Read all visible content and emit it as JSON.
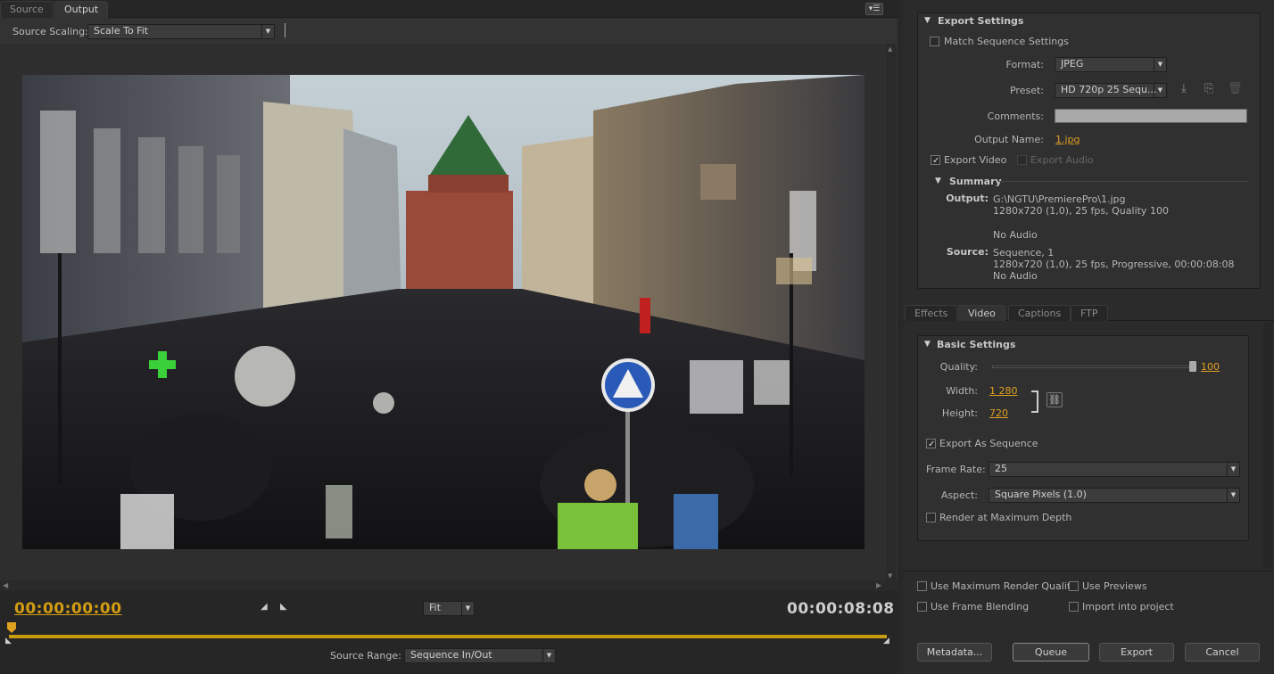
{
  "tabs": {
    "source": "Source",
    "output": "Output"
  },
  "scaling": {
    "label": "Source Scaling:",
    "value": "Scale To Fit"
  },
  "playback": {
    "current_tc": "00:00:00:00",
    "duration_tc": "00:00:08:08",
    "zoom": "Fit",
    "range_label": "Source Range:",
    "range_value": "Sequence In/Out"
  },
  "export_settings": {
    "header": "Export Settings",
    "match_label": "Match Sequence Settings",
    "format_label": "Format:",
    "format_value": "JPEG",
    "preset_label": "Preset:",
    "preset_value": "HD 720p 25 Sequ...",
    "comments_label": "Comments:",
    "output_name_label": "Output Name:",
    "output_name_value": "1.jpg",
    "export_video": "Export Video",
    "export_audio": "Export Audio"
  },
  "summary": {
    "header": "Summary",
    "output_label": "Output:",
    "output_lines": [
      "G:\\NGTU\\PremierePro\\1.jpg",
      "1280x720 (1,0), 25 fps, Quality 100",
      "No Audio"
    ],
    "source_label": "Source:",
    "source_lines": [
      "Sequence, 1",
      "1280x720 (1,0), 25 fps, Progressive, 00:00:08:08",
      "No Audio"
    ]
  },
  "right_tabs": [
    "Effects",
    "Video",
    "Captions",
    "FTP"
  ],
  "basic": {
    "header": "Basic Settings",
    "quality_label": "Quality:",
    "quality_value": "100",
    "quality_fraction": 1.0,
    "width_label": "Width:",
    "width_value": "1 280",
    "height_label": "Height:",
    "height_value": "720",
    "export_seq": "Export As Sequence",
    "frame_rate_label": "Frame Rate:",
    "frame_rate_value": "25",
    "aspect_label": "Aspect:",
    "aspect_value": "Square Pixels (1.0)",
    "render_max": "Render at Maximum Depth"
  },
  "options": {
    "max_quality": "Use Maximum Render Quality",
    "use_previews": "Use Previews",
    "frame_blending": "Use Frame Blending",
    "import_project": "Import into project"
  },
  "buttons": {
    "metadata": "Metadata...",
    "queue": "Queue",
    "export": "Export",
    "cancel": "Cancel"
  },
  "colors": {
    "accent": "#e0a020",
    "timecode": "#d39c12",
    "background": "#282828"
  }
}
